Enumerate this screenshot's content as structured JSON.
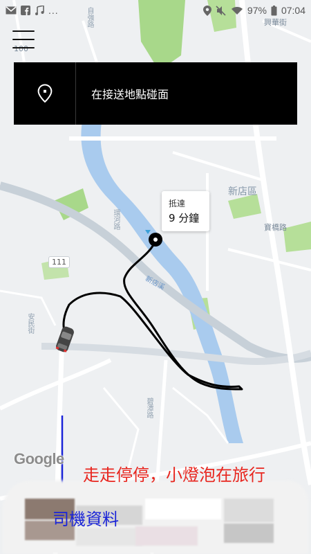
{
  "status_bar": {
    "left_icons": [
      "mail-icon",
      "facebook-icon",
      "music-icon"
    ],
    "overflow": "...",
    "right_icons": [
      "location-icon",
      "mute-icon",
      "wifi-icon"
    ],
    "battery_percent": "97%",
    "time": "07:04"
  },
  "map": {
    "labels": {
      "district": "新店區",
      "route_number": "111",
      "river": "新店溪",
      "road_top": "自強路",
      "road_riverside": "環河路",
      "road_east": "寶橋路",
      "road_anmin": "安民街",
      "road_south": "碧潭路",
      "road_top_left": "100",
      "place_top_right": "興華街"
    }
  },
  "menu": {
    "icon": "hamburger-menu-icon"
  },
  "pickup": {
    "icon": "location-pin-icon",
    "text": "在接送地點碰面"
  },
  "eta": {
    "label": "抵達",
    "time": "9 分鐘"
  },
  "google_logo": "Google",
  "annotation": {
    "caption": "走走停停，小燈泡在旅行",
    "driver_info": "司機資料"
  },
  "colors": {
    "map_background": "#eef0f2",
    "park_green": "#a8d88a",
    "river_blue": "#a9cbee",
    "route_line": "#000000",
    "annotation_red": "#e8261f",
    "annotation_blue": "#1a24d8"
  }
}
